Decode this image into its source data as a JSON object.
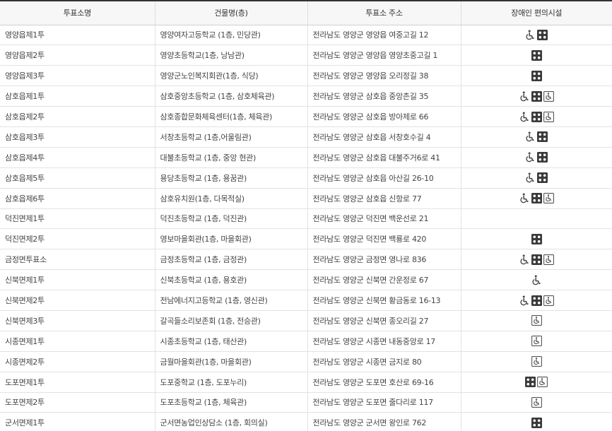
{
  "headers": [
    "투표소명",
    "건물명(층)",
    "투표소 주소",
    "장애인 편의시설"
  ],
  "rows": [
    {
      "name": "영양읍제1투",
      "building": "영양여자고등학교 (1층, 민당관)",
      "address": "전라남도 영양군 영양읍 여중고길 12",
      "icons": [
        "wheelchair-icon",
        "braille-icon"
      ]
    },
    {
      "name": "영양읍제2투",
      "building": "영양초등학교(1층, 낭남관)",
      "address": "전라남도 영양군 영양읍 영양초중고길 1",
      "icons": [
        "braille-icon"
      ]
    },
    {
      "name": "영양읍제3투",
      "building": "영양군노인복지회관(1층, 식당)",
      "address": "전라남도 영양군 영양읍 오리정길 38",
      "icons": [
        "braille-icon"
      ]
    },
    {
      "name": "삼호읍제1투",
      "building": "삼호중앙초등학교 (1층, 삼호체육관)",
      "address": "전라남도 영양군 삼호읍 중앙촌길 35",
      "icons": [
        "wheelchair-icon",
        "braille-icon",
        "accessible-booth-icon"
      ]
    },
    {
      "name": "삼호읍제2투",
      "building": "삼호종합문화체육센터(1층, 체육관)",
      "address": "전라남도 영양군 삼호읍 방아제로 66",
      "icons": [
        "wheelchair-icon",
        "braille-icon",
        "accessible-booth-icon"
      ]
    },
    {
      "name": "삼호읍제3투",
      "building": "서창초등학교 (1층,어울림관)",
      "address": "전라남도 영양군 삼호읍 서창호수길 4",
      "icons": [
        "wheelchair-icon",
        "braille-icon"
      ]
    },
    {
      "name": "삼호읍제4투",
      "building": "대불초등학교 (1층, 중앙 현관)",
      "address": "전라남도 영양군 삼호읍 대불주거6로 41",
      "icons": [
        "wheelchair-icon",
        "braille-icon"
      ]
    },
    {
      "name": "삼호읍제5투",
      "building": "용당초등학교 (1층, 용꿈관)",
      "address": "전라남도 영양군 삼호읍 아산길 26-10",
      "icons": [
        "wheelchair-icon",
        "braille-icon"
      ]
    },
    {
      "name": "삼호읍제6투",
      "building": "삼호유치원(1층, 다목적실)",
      "address": "전라남도 영양군 삼호읍 신항로 77",
      "icons": [
        "wheelchair-icon",
        "braille-icon",
        "accessible-booth-icon"
      ]
    },
    {
      "name": "덕진면제1투",
      "building": "덕진초등학교 (1층, 덕진관)",
      "address": "전라남도 영양군 덕진면 백운선로 21",
      "icons": []
    },
    {
      "name": "덕진면제2투",
      "building": "영보마을회관(1층, 마을회관)",
      "address": "전라남도 영양군 덕진면 백룡로 420",
      "icons": [
        "braille-icon"
      ]
    },
    {
      "name": "금정면투표소",
      "building": "금정초등학교 (1층, 금정관)",
      "address": "전라남도 영양군 금정면 영나로 836",
      "icons": [
        "wheelchair-icon",
        "braille-icon",
        "accessible-booth-icon"
      ]
    },
    {
      "name": "신북면제1투",
      "building": "신북초등학교 (1층, 용호관)",
      "address": "전라남도 영양군 신북면 간운정로 67",
      "icons": [
        "wheelchair-icon"
      ]
    },
    {
      "name": "신북면제2투",
      "building": "전남에너지고등학교 (1층, 영신관)",
      "address": "전라남도 영양군 신북면 황금동로 16-13",
      "icons": [
        "wheelchair-icon",
        "braille-icon",
        "accessible-booth-icon"
      ]
    },
    {
      "name": "신북면제3투",
      "building": "갈곡들소리보존회 (1층, 전승관)",
      "address": "전라남도 영양군 신북면 종오리길 27",
      "icons": [
        "accessible-booth-icon"
      ]
    },
    {
      "name": "시종면제1투",
      "building": "시종초등학교 (1층, 태산관)",
      "address": "전라남도 영양군 시종면 내동중앙로 17",
      "icons": [
        "accessible-booth-icon"
      ]
    },
    {
      "name": "시종면제2투",
      "building": "금월마을회관(1층, 마을회관)",
      "address": "전라남도 영양군 시종면 금지로 80",
      "icons": [
        "accessible-booth-icon"
      ]
    },
    {
      "name": "도포면제1투",
      "building": "도포중학교 (1층, 도포누리)",
      "address": "전라남도 영양군 도포면 호산로 69-16",
      "icons": [
        "braille-icon",
        "accessible-booth-icon"
      ]
    },
    {
      "name": "도포면제2투",
      "building": "도포초등학교 (1층, 체육관)",
      "address": "전라남도 영양군 도포면 줄다리로 117",
      "icons": [
        "accessible-booth-icon"
      ]
    },
    {
      "name": "군서면제1투",
      "building": "군서면농업인상담소 (1층, 회의실)",
      "address": "전라남도 영양군 군서면 왕인로 762",
      "icons": [
        "braille-icon"
      ]
    }
  ]
}
